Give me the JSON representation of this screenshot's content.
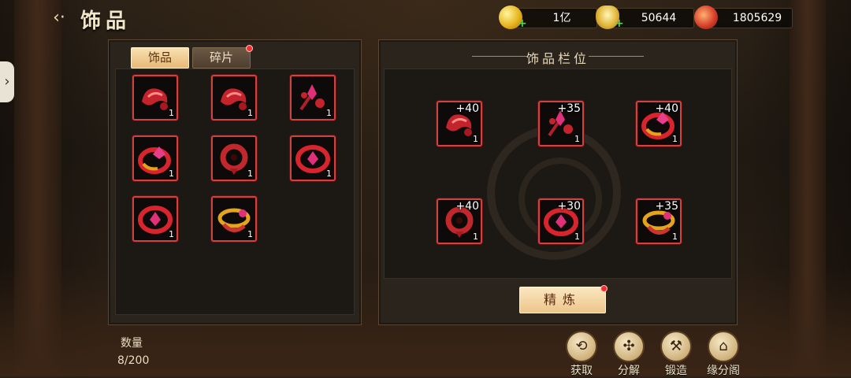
{
  "header": {
    "title": "饰品",
    "back_icon": "back-arrow-icon"
  },
  "resources": [
    {
      "icon": "gold-coin-icon",
      "value": "1亿",
      "plus": "+"
    },
    {
      "icon": "gold-ingot-icon",
      "value": "50644",
      "plus": "+"
    },
    {
      "icon": "red-token-icon",
      "value": "1805629"
    }
  ],
  "inventory": {
    "tabs": [
      {
        "label": "饰品",
        "active": true
      },
      {
        "label": "碎片",
        "active": false,
        "badge": true
      }
    ],
    "items": [
      {
        "type": "earring",
        "count": "1"
      },
      {
        "type": "earring",
        "count": "1"
      },
      {
        "type": "hairpin",
        "count": "1"
      },
      {
        "type": "gold-ring",
        "count": "1"
      },
      {
        "type": "pendant",
        "count": "1"
      },
      {
        "type": "ruby-ring",
        "count": "1"
      },
      {
        "type": "ruby-ring",
        "count": "1"
      },
      {
        "type": "jade-ring",
        "count": "1"
      }
    ],
    "quantity_label": "数量",
    "quantity_value": "8/200"
  },
  "slots": {
    "title": "饰品栏位",
    "items": [
      {
        "type": "earring",
        "bonus": "+40",
        "count": "1"
      },
      {
        "type": "hairpin",
        "bonus": "+35",
        "count": "1"
      },
      {
        "type": "gold-ring",
        "bonus": "+40",
        "count": "1"
      },
      {
        "type": "pendant",
        "bonus": "+40",
        "count": "1"
      },
      {
        "type": "ruby-ring",
        "bonus": "+30",
        "count": "1"
      },
      {
        "type": "jade-ring",
        "bonus": "+35",
        "count": "1"
      }
    ],
    "refine_label": "精炼"
  },
  "actions": [
    {
      "label": "获取",
      "icon": "acquire-icon"
    },
    {
      "label": "分解",
      "icon": "decompose-icon"
    },
    {
      "label": "锻造",
      "icon": "forge-hammer-icon"
    },
    {
      "label": "缘分阁",
      "icon": "pavilion-icon"
    }
  ],
  "colors": {
    "item_border": "#d24040",
    "badge": "#ff2a2a",
    "tab_active": "#e8b976"
  }
}
